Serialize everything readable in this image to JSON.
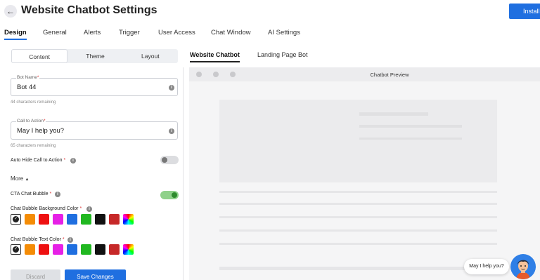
{
  "header": {
    "title": "Website Chatbot Settings",
    "install_label": "Install"
  },
  "main_tabs": [
    "Design",
    "General",
    "Alerts",
    "Trigger",
    "User Access",
    "Chat Window",
    "AI Settings"
  ],
  "segments": [
    "Content",
    "Theme",
    "Layout"
  ],
  "bot_name": {
    "label": "Bot Name",
    "required": "*",
    "value": "Bot 44",
    "helper": "44 characters remaining"
  },
  "cta": {
    "label": "Call to Action",
    "required": "*",
    "value": "May I help you?",
    "helper": "65 characters remaining"
  },
  "auto_hide": {
    "label": "Auto Hide Call to Action",
    "required": "*",
    "enabled": false
  },
  "more_label": "More",
  "cta_bubble": {
    "label": "CTA Chat Bubble",
    "required": "*",
    "enabled": true
  },
  "bg_color": {
    "label": "Chat Bubble Background Color",
    "required": "*",
    "selected": "#ffffff",
    "colors": [
      "#f48c06",
      "#ee1111",
      "#e620e6",
      "#1f6fe0",
      "#21b821",
      "#111111",
      "#c62828"
    ]
  },
  "text_color": {
    "label": "Chat Bubble Text Color",
    "required": "*",
    "selected": "#ffffff",
    "colors": [
      "#f48c06",
      "#ee1111",
      "#e620e6",
      "#1f6fe0",
      "#21b821",
      "#111111",
      "#c62828"
    ]
  },
  "actions": {
    "discard": "Discard",
    "save": "Save Changes"
  },
  "preview_tabs": [
    "Website Chatbot",
    "Landing Page Bot"
  ],
  "preview": {
    "title": "Chatbot Preview",
    "bubble_text": "May I help you?"
  }
}
